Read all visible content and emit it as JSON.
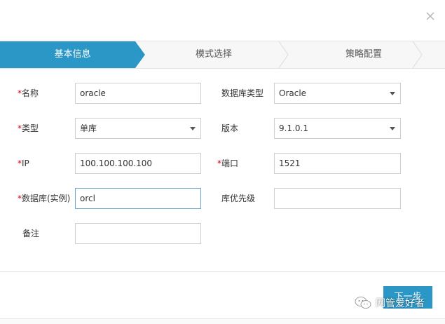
{
  "steps": [
    "基本信息",
    "模式选择",
    "策略配置"
  ],
  "form": {
    "name": {
      "label": "名称",
      "value": "oracle"
    },
    "db_type": {
      "label": "数据库类型",
      "value": "Oracle"
    },
    "type": {
      "label": "类型",
      "value": "单库"
    },
    "version": {
      "label": "版本",
      "value": "9.1.0.1"
    },
    "ip": {
      "label": "IP",
      "value": "100.100.100.100"
    },
    "port": {
      "label": "端口",
      "value": "1521"
    },
    "instance": {
      "label": "数据库(实例)",
      "value": "orcl"
    },
    "priority": {
      "label": "库优先级",
      "value": ""
    },
    "remark": {
      "label": "备注",
      "value": ""
    }
  },
  "required_mark": "*",
  "footer": {
    "next_label": "下一步"
  },
  "watermark": {
    "text": "网管爱好者"
  },
  "colors": {
    "accent": "#2b97c7",
    "required": "#d0021b"
  }
}
